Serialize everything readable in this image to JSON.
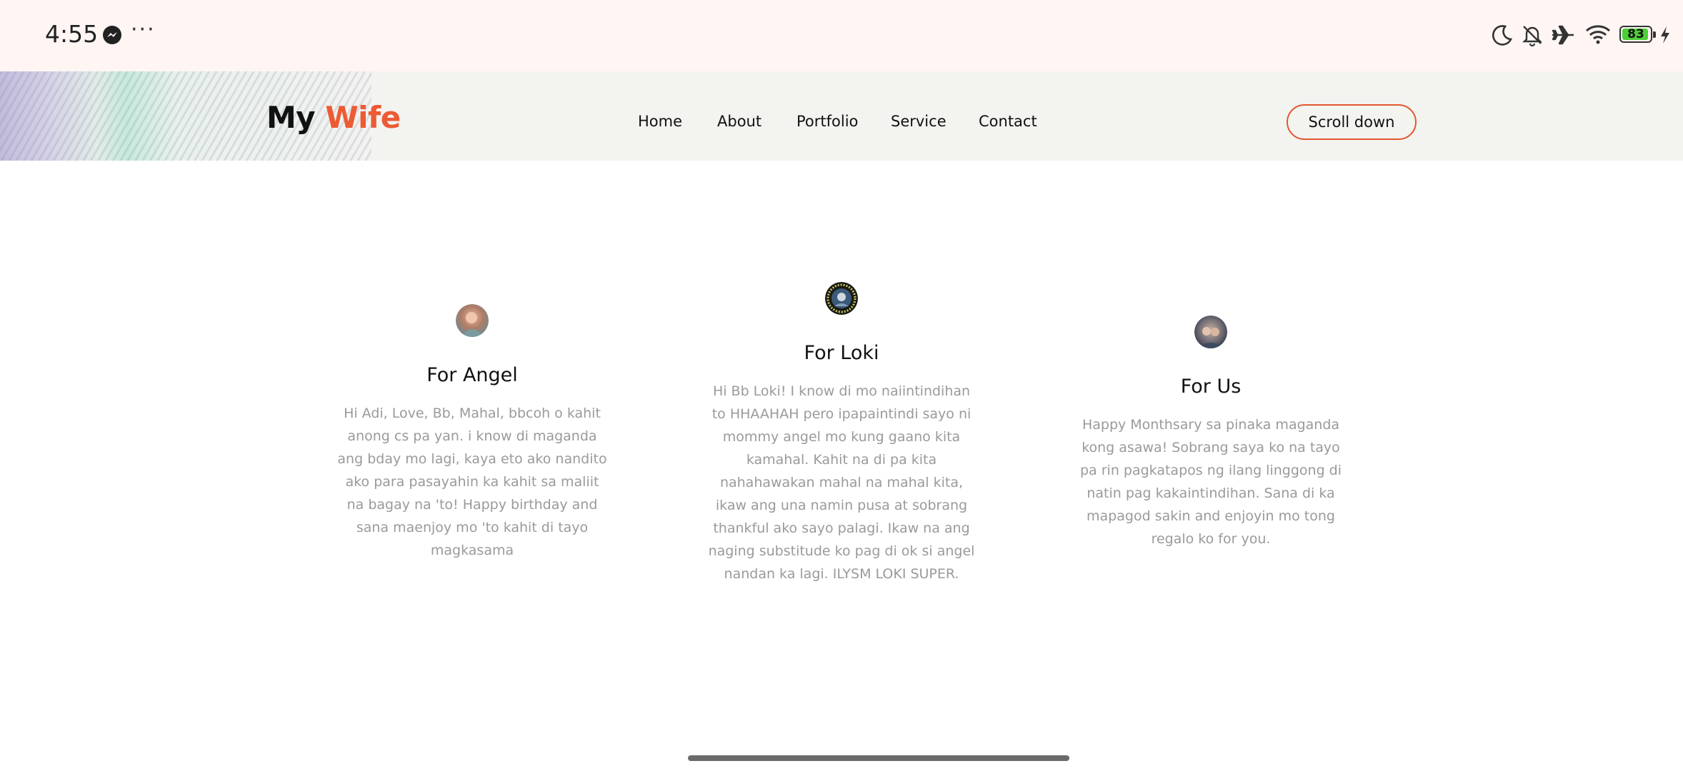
{
  "status_bar": {
    "time": "4:55",
    "overflow": "···",
    "battery_level": "83",
    "icons": [
      "messenger-icon",
      "moon-icon",
      "bell-muted-icon",
      "airplane-icon",
      "wifi-icon",
      "battery-icon",
      "charging-icon"
    ]
  },
  "header": {
    "logo_part1": "My",
    "logo_part2": "Wife",
    "accent_color": "#ec5b34",
    "nav": [
      "Home",
      "About",
      "Portfolio",
      "Service",
      "Contact"
    ],
    "cta": "Scroll down"
  },
  "cards": [
    {
      "title": "For Angel",
      "text": "Hi Adi, Love, Bb, Mahal, bbcoh o kahit anong cs pa yan. i know di maganda ang bday mo lagi, kaya eto ako nandito ako para pasayahin ka kahit sa maliit na bagay na 'to! Happy birthday and sana maenjoy mo 'to kahit di tayo magkasama"
    },
    {
      "title": "For Loki",
      "text": "Hi Bb Loki! I know di mo naiintindihan to HHAAHAH pero ipapaintindi sayo ni mommy angel mo kung gaano kita kamahal. Kahit na di pa kita nahahawakan mahal na mahal kita, ikaw ang una namin pusa at sobrang thankful ako sayo palagi. Ikaw na ang naging substitude ko pag di ok si angel nandan ka lagi. ILYSM LOKI SUPER."
    },
    {
      "title": "For Us",
      "text": "Happy Monthsary sa pinaka maganda kong asawa! Sobrang saya ko na tayo pa rin pagkatapos ng ilang linggong di natin pag kakaintindihan. Sana di ka mapagod sakin and enjoyin mo tong regalo ko for you."
    }
  ]
}
